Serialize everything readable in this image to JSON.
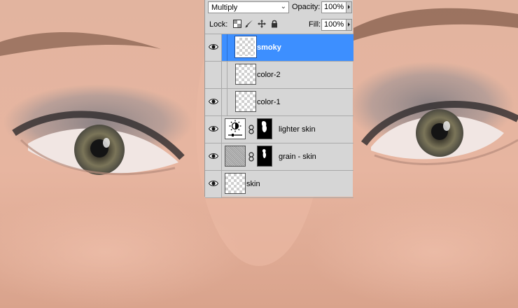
{
  "layers_panel": {
    "blend_mode": "Multiply",
    "opacity_label": "Opacity:",
    "opacity_value": "100%",
    "lock_label": "Lock:",
    "fill_label": "Fill:",
    "fill_value": "100%",
    "layers": [
      {
        "name": "smoky",
        "selected": true,
        "visible": true,
        "type": "pixel",
        "clipped": true
      },
      {
        "name": "color-2",
        "selected": false,
        "visible": false,
        "type": "pixel",
        "clipped": true
      },
      {
        "name": "color-1",
        "selected": false,
        "visible": true,
        "type": "pixel",
        "clipped": true
      },
      {
        "name": "lighter skin",
        "selected": false,
        "visible": true,
        "type": "adjustment",
        "mask": true
      },
      {
        "name": "grain - skin",
        "selected": false,
        "visible": true,
        "type": "smart-filter",
        "mask": true
      },
      {
        "name": "skin",
        "selected": false,
        "visible": true,
        "type": "pixel"
      }
    ]
  },
  "icons": [
    "eye-icon",
    "lock-transparent-icon",
    "lock-brush-icon",
    "lock-move-icon",
    "lock-all-icon",
    "chain-link-icon",
    "brightness-adjustment-icon"
  ],
  "colors": {
    "panel_bg": "#d6d6d6",
    "selection": "#3d8fff",
    "skin": "#e4b19d"
  }
}
